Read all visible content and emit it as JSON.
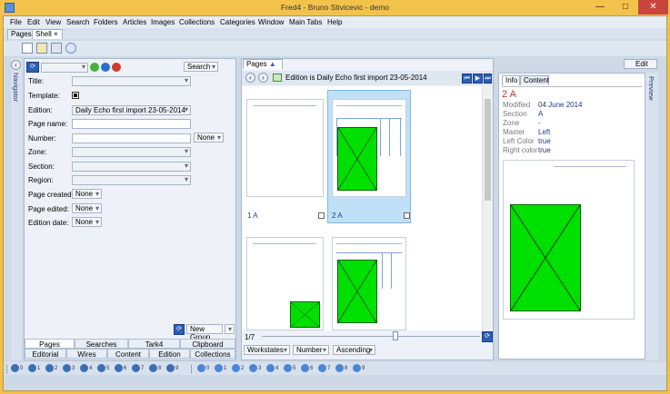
{
  "window": {
    "title": "Fred4 - Bruno Stivicevic - demo",
    "minimize": "—",
    "maximize": "□",
    "close": "✕"
  },
  "menu": [
    "File",
    "Edit",
    "View",
    "Search",
    "Folders",
    "Articles",
    "Images",
    "Collections",
    "Categories",
    "Window",
    "Main Tabs",
    "Help"
  ],
  "doc_tabs": [
    {
      "label": "Pages"
    },
    {
      "label": "Shell",
      "close": "×"
    }
  ],
  "right_tab": "Edit",
  "navigator": {
    "vertical_label": "Navigator",
    "search_button": "Search",
    "fields": {
      "title": {
        "label": "Title:"
      },
      "template": {
        "label": "Template:"
      },
      "edition": {
        "label": "Edition:",
        "value": "Daily Echo first import 23-05-2014"
      },
      "page_name": {
        "label": "Page name:",
        "value": ""
      },
      "number": {
        "label": "Number:",
        "value": "",
        "option": "None"
      },
      "zone": {
        "label": "Zone:"
      },
      "section": {
        "label": "Section:"
      },
      "region": {
        "label": "Region:"
      },
      "page_created": {
        "label": "Page created:",
        "value": "None"
      },
      "page_edited": {
        "label": "Page edited:",
        "value": "None"
      },
      "edition_date": {
        "label": "Edition date:",
        "value": "None"
      }
    },
    "new_group": "New Group",
    "bottom_tabs_row1": [
      "Pages",
      "Searches",
      "Tark4",
      "Clipboard"
    ],
    "bottom_tabs_row2": [
      "Editorial",
      "Wires",
      "Content",
      "Edition",
      "Collections"
    ]
  },
  "pages_panel": {
    "tab_label": "Pages",
    "tab_close": "×",
    "edition_header": "Edition is Daily Echo first import 23-05-2014",
    "thumbs": [
      {
        "label": "1 A"
      },
      {
        "label": "2 A",
        "selected": true
      },
      {
        "label": ""
      },
      {
        "label": ""
      }
    ],
    "page_counter": "1/7",
    "footer_buttons": [
      "Workstates",
      "Number",
      "Ascending"
    ]
  },
  "info_panel": {
    "tabs": [
      "Info",
      "Content"
    ],
    "active_tab": "Info",
    "page_title": "2 A",
    "rows": [
      {
        "key": "Modified",
        "value": "04 June 2014"
      },
      {
        "key": "Section",
        "value": "A"
      },
      {
        "key": "Zone",
        "value": "-"
      },
      {
        "key": "Master",
        "value": "Left"
      },
      {
        "key": "Left Color",
        "value": "true"
      },
      {
        "key": "Right color",
        "value": "true"
      }
    ],
    "preview_label": "Preview"
  },
  "statusbar": {
    "counts_a": [
      "0",
      "1",
      "2",
      "3",
      "4",
      "5",
      "6",
      "7",
      "8",
      "9"
    ],
    "counts_b": [
      "0",
      "1",
      "2",
      "3",
      "4",
      "5",
      "6",
      "7",
      "8",
      "9"
    ]
  },
  "colors": {
    "accent": "#2a5fb8",
    "placeholder_green": "#00e000",
    "selected": "#bfe0f7",
    "title_bar": "#f3c24a"
  }
}
